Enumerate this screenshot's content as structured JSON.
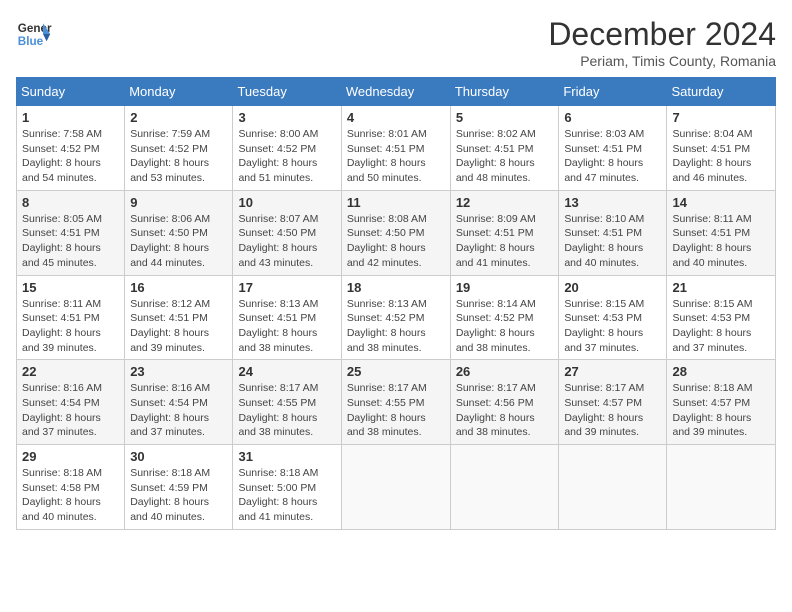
{
  "header": {
    "logo_line1": "General",
    "logo_line2": "Blue",
    "month_title": "December 2024",
    "subtitle": "Periam, Timis County, Romania"
  },
  "weekdays": [
    "Sunday",
    "Monday",
    "Tuesday",
    "Wednesday",
    "Thursday",
    "Friday",
    "Saturday"
  ],
  "weeks": [
    [
      {
        "day": "1",
        "info": "Sunrise: 7:58 AM\nSunset: 4:52 PM\nDaylight: 8 hours\nand 54 minutes."
      },
      {
        "day": "2",
        "info": "Sunrise: 7:59 AM\nSunset: 4:52 PM\nDaylight: 8 hours\nand 53 minutes."
      },
      {
        "day": "3",
        "info": "Sunrise: 8:00 AM\nSunset: 4:52 PM\nDaylight: 8 hours\nand 51 minutes."
      },
      {
        "day": "4",
        "info": "Sunrise: 8:01 AM\nSunset: 4:51 PM\nDaylight: 8 hours\nand 50 minutes."
      },
      {
        "day": "5",
        "info": "Sunrise: 8:02 AM\nSunset: 4:51 PM\nDaylight: 8 hours\nand 48 minutes."
      },
      {
        "day": "6",
        "info": "Sunrise: 8:03 AM\nSunset: 4:51 PM\nDaylight: 8 hours\nand 47 minutes."
      },
      {
        "day": "7",
        "info": "Sunrise: 8:04 AM\nSunset: 4:51 PM\nDaylight: 8 hours\nand 46 minutes."
      }
    ],
    [
      {
        "day": "8",
        "info": "Sunrise: 8:05 AM\nSunset: 4:51 PM\nDaylight: 8 hours\nand 45 minutes."
      },
      {
        "day": "9",
        "info": "Sunrise: 8:06 AM\nSunset: 4:50 PM\nDaylight: 8 hours\nand 44 minutes."
      },
      {
        "day": "10",
        "info": "Sunrise: 8:07 AM\nSunset: 4:50 PM\nDaylight: 8 hours\nand 43 minutes."
      },
      {
        "day": "11",
        "info": "Sunrise: 8:08 AM\nSunset: 4:50 PM\nDaylight: 8 hours\nand 42 minutes."
      },
      {
        "day": "12",
        "info": "Sunrise: 8:09 AM\nSunset: 4:51 PM\nDaylight: 8 hours\nand 41 minutes."
      },
      {
        "day": "13",
        "info": "Sunrise: 8:10 AM\nSunset: 4:51 PM\nDaylight: 8 hours\nand 40 minutes."
      },
      {
        "day": "14",
        "info": "Sunrise: 8:11 AM\nSunset: 4:51 PM\nDaylight: 8 hours\nand 40 minutes."
      }
    ],
    [
      {
        "day": "15",
        "info": "Sunrise: 8:11 AM\nSunset: 4:51 PM\nDaylight: 8 hours\nand 39 minutes."
      },
      {
        "day": "16",
        "info": "Sunrise: 8:12 AM\nSunset: 4:51 PM\nDaylight: 8 hours\nand 39 minutes."
      },
      {
        "day": "17",
        "info": "Sunrise: 8:13 AM\nSunset: 4:51 PM\nDaylight: 8 hours\nand 38 minutes."
      },
      {
        "day": "18",
        "info": "Sunrise: 8:13 AM\nSunset: 4:52 PM\nDaylight: 8 hours\nand 38 minutes."
      },
      {
        "day": "19",
        "info": "Sunrise: 8:14 AM\nSunset: 4:52 PM\nDaylight: 8 hours\nand 38 minutes."
      },
      {
        "day": "20",
        "info": "Sunrise: 8:15 AM\nSunset: 4:53 PM\nDaylight: 8 hours\nand 37 minutes."
      },
      {
        "day": "21",
        "info": "Sunrise: 8:15 AM\nSunset: 4:53 PM\nDaylight: 8 hours\nand 37 minutes."
      }
    ],
    [
      {
        "day": "22",
        "info": "Sunrise: 8:16 AM\nSunset: 4:54 PM\nDaylight: 8 hours\nand 37 minutes."
      },
      {
        "day": "23",
        "info": "Sunrise: 8:16 AM\nSunset: 4:54 PM\nDaylight: 8 hours\nand 37 minutes."
      },
      {
        "day": "24",
        "info": "Sunrise: 8:17 AM\nSunset: 4:55 PM\nDaylight: 8 hours\nand 38 minutes."
      },
      {
        "day": "25",
        "info": "Sunrise: 8:17 AM\nSunset: 4:55 PM\nDaylight: 8 hours\nand 38 minutes."
      },
      {
        "day": "26",
        "info": "Sunrise: 8:17 AM\nSunset: 4:56 PM\nDaylight: 8 hours\nand 38 minutes."
      },
      {
        "day": "27",
        "info": "Sunrise: 8:17 AM\nSunset: 4:57 PM\nDaylight: 8 hours\nand 39 minutes."
      },
      {
        "day": "28",
        "info": "Sunrise: 8:18 AM\nSunset: 4:57 PM\nDaylight: 8 hours\nand 39 minutes."
      }
    ],
    [
      {
        "day": "29",
        "info": "Sunrise: 8:18 AM\nSunset: 4:58 PM\nDaylight: 8 hours\nand 40 minutes."
      },
      {
        "day": "30",
        "info": "Sunrise: 8:18 AM\nSunset: 4:59 PM\nDaylight: 8 hours\nand 40 minutes."
      },
      {
        "day": "31",
        "info": "Sunrise: 8:18 AM\nSunset: 5:00 PM\nDaylight: 8 hours\nand 41 minutes."
      },
      {
        "day": "",
        "info": ""
      },
      {
        "day": "",
        "info": ""
      },
      {
        "day": "",
        "info": ""
      },
      {
        "day": "",
        "info": ""
      }
    ]
  ]
}
